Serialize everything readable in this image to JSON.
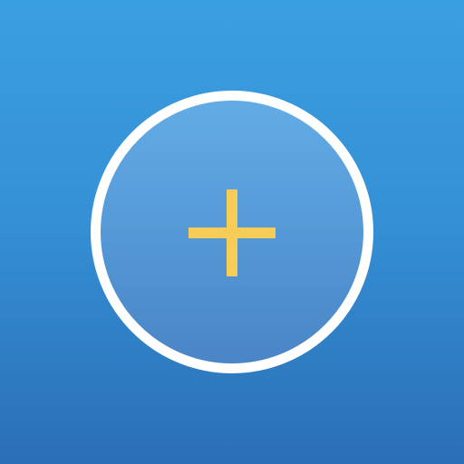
{
  "screen": {
    "background_top": "#3a9fe0",
    "background_bottom": "#2b6fb6"
  },
  "add_button": {
    "icon": "plus-icon",
    "ring_color": "#ffffff",
    "fill_color": "#5599d6",
    "icon_color": "#f7cd58"
  }
}
